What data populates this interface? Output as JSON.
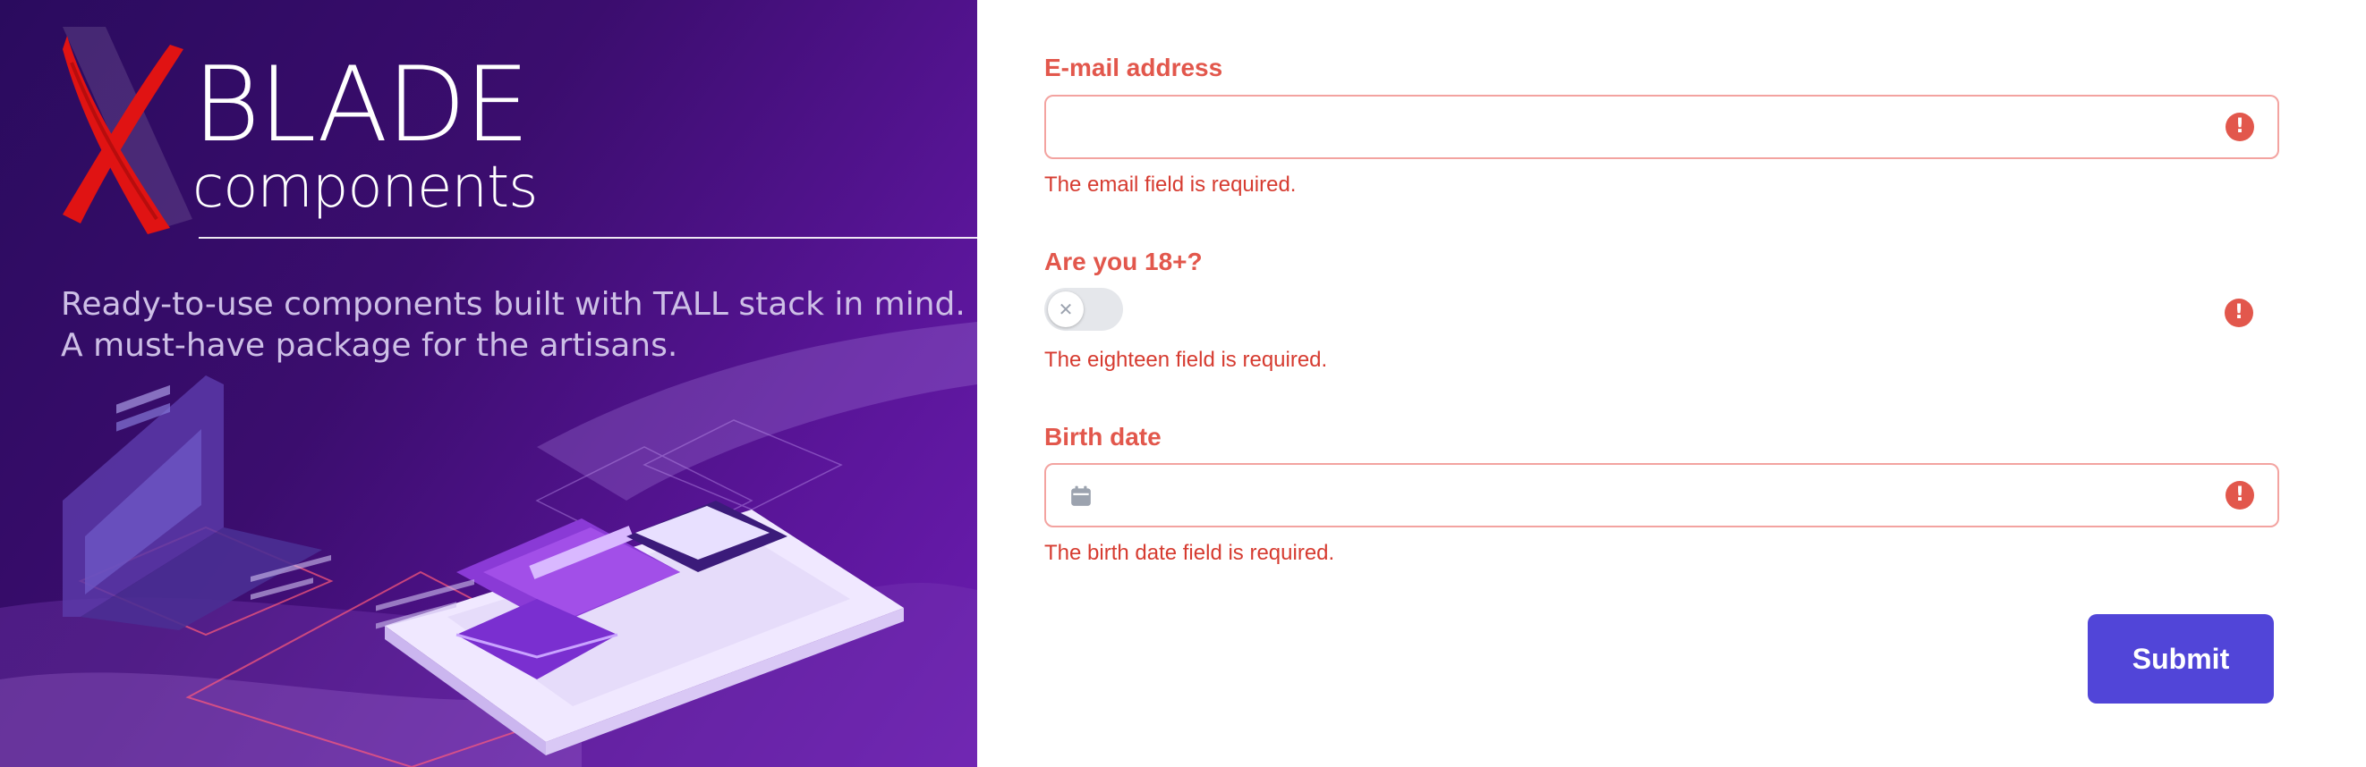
{
  "hero": {
    "brand_word": "BLADE",
    "brand_sub": "components",
    "tagline_line1": "Ready-to-use components built with TALL stack in mind.",
    "tagline_line2": "A must-have package for the artisans.",
    "logo_letter": "X",
    "colors": {
      "bg_dark": "#2a0b5e",
      "bg_light": "#6b1db0",
      "logo_red": "#e01313"
    }
  },
  "form": {
    "email": {
      "label": "E-mail address",
      "value": "",
      "error": "The email field is required."
    },
    "eighteen": {
      "label": "Are you 18+?",
      "checked": false,
      "error": "The eighteen field is required."
    },
    "birth_date": {
      "label": "Birth date",
      "value": "",
      "error": "The birth date field is required."
    },
    "submit_label": "Submit",
    "icons": {
      "error": "exclamation-circle-icon",
      "calendar": "calendar-icon",
      "toggle_off": "x-icon"
    },
    "colors": {
      "error": "#e2574c",
      "error_border": "#f3a3a0",
      "primary": "#5145d8"
    }
  }
}
